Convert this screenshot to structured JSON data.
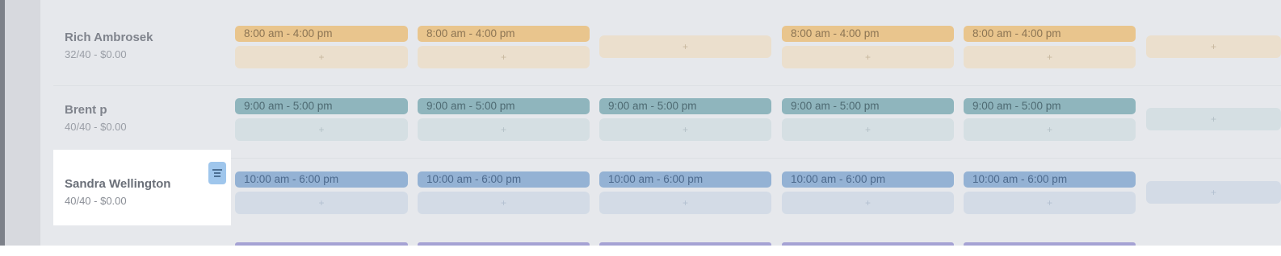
{
  "employees": [
    {
      "name": "Rich Ambrosek",
      "hours": "32/40 - $0.00",
      "color": "#e9c58d",
      "shifts": [
        "8:00 am - 4:00 pm",
        "8:00 am - 4:00 pm",
        "",
        "8:00 am - 4:00 pm",
        "8:00 am - 4:00 pm",
        ""
      ]
    },
    {
      "name": "Brent p",
      "hours": "40/40 - $0.00",
      "color": "#8fb5bd",
      "shifts": [
        "9:00 am - 5:00 pm",
        "9:00 am - 5:00 pm",
        "9:00 am - 5:00 pm",
        "9:00 am - 5:00 pm",
        "9:00 am - 5:00 pm",
        ""
      ]
    },
    {
      "name": "Sandra Wellington",
      "hours": "40/40 - $0.00",
      "color": "#94b2d4",
      "highlighted": true,
      "shifts": [
        "10:00 am - 6:00 pm",
        "10:00 am - 6:00 pm",
        "10:00 am - 6:00 pm",
        "10:00 am - 6:00 pm",
        "10:00 am - 6:00 pm",
        ""
      ]
    }
  ],
  "add_symbol": "+",
  "icons": {
    "note": "note-icon",
    "add": "plus-icon"
  },
  "colors": {
    "orange_shift": "#e9c58d",
    "teal_shift": "#8fb5bd",
    "blue_shift": "#94b2d4",
    "purple_shift": "#a5a2d4",
    "note_icon_bg": "#9fc6ec",
    "overlay_bg": "#e6e8ec"
  }
}
